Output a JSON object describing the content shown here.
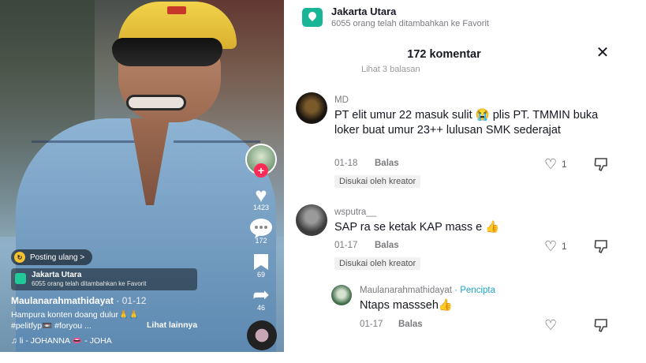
{
  "video": {
    "repost_label": "Posting ulang >",
    "location_title": "Jakarta Utara",
    "location_sub": "6055 orang telah ditambahkan ke Favorit",
    "author": "Maulanarahmathidayat",
    "post_date": "· 01-12",
    "caption_line1": "Hampura konten doang dulur🙏🙏",
    "caption_line2": "#pelitfyp📼 #foryou ...",
    "see_more": "Lihat lainnya",
    "music": "♫ li - JOHANNA 👄 - JOHA",
    "actions": {
      "likes": "1423",
      "comments": "172",
      "saves": "69",
      "shares": "46"
    }
  },
  "comments_panel": {
    "location_title": "Jakarta Utara",
    "location_sub": "6055 orang telah ditambahkan ke Favorit",
    "title": "172 komentar",
    "close_glyph": "✕",
    "cut_text": "Lihat 3 balasan",
    "comments": [
      {
        "username": "MD",
        "text": "PT elit umur 22 masuk sulit 😭 plis PT. TMMIN buka loker buat umur 23++ lulusan SMK sederajat",
        "date": "01-18",
        "reply": "Balas",
        "likes": "1",
        "badge": "Disukai oleh kreator"
      },
      {
        "username": "wsputra__",
        "text": "SAP ra se ketak KAP mass e 👍",
        "date": "01-17",
        "reply": "Balas",
        "likes": "1",
        "badge": "Disukai oleh kreator"
      },
      {
        "username": "Maulanarahmathidayat",
        "creator_tag": "· Pencipta",
        "text": "Ntaps massseh👍",
        "date": "01-17",
        "reply": "Balas",
        "likes": ""
      }
    ]
  },
  "icons": {
    "like": "♡",
    "heart_filled": "♥",
    "dislike": "👎",
    "share": "➦"
  }
}
